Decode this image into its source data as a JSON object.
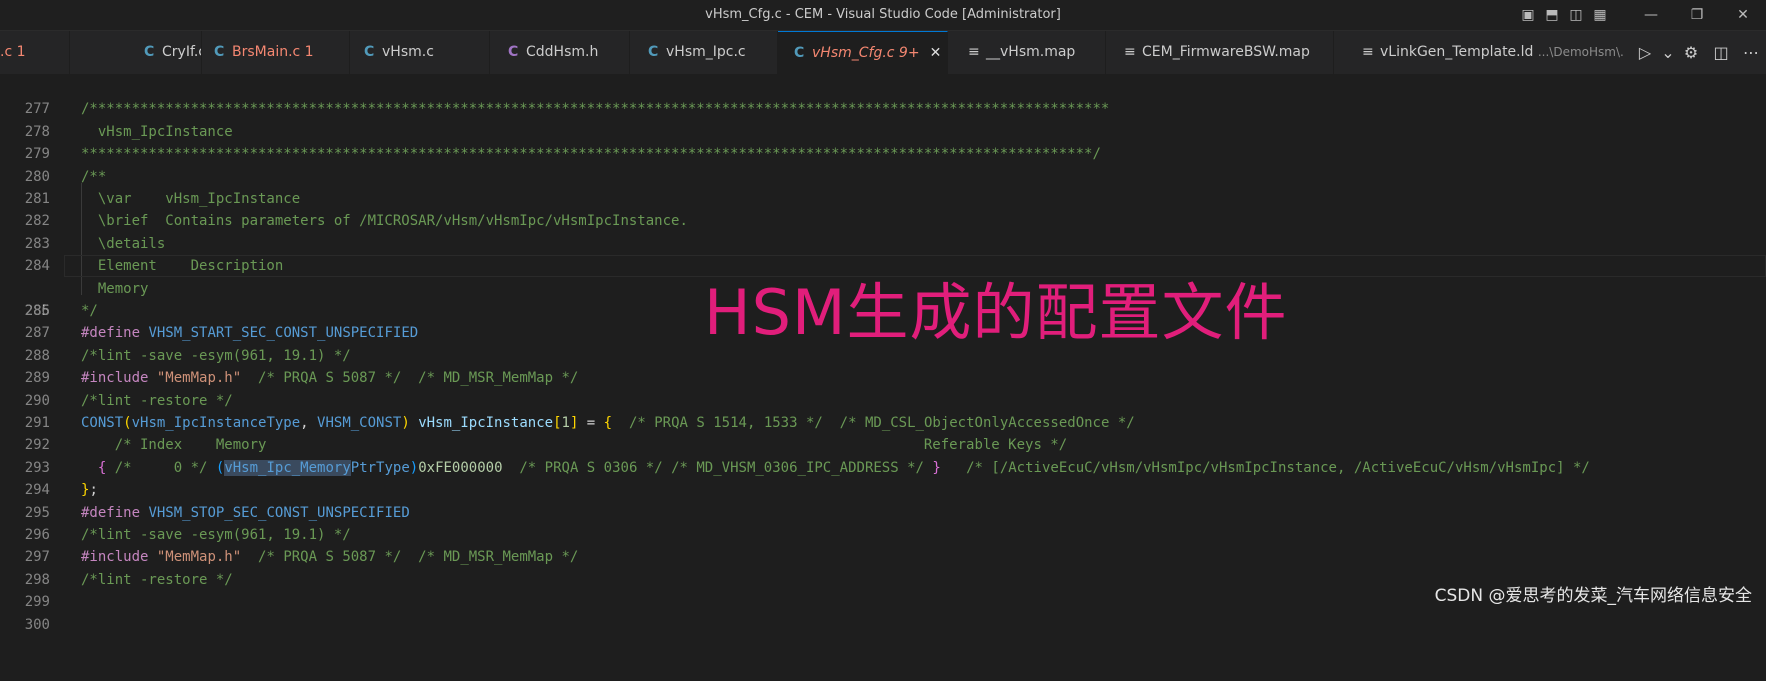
{
  "window": {
    "title": "vHsm_Cfg.c - CEM - Visual Studio Code [Administrator]",
    "controls": [
      "layout-sidebar-icon",
      "layout-panel-icon",
      "layout-sidebar-right-icon",
      "layout-custom-icon",
      "minimize-icon",
      "restore-icon",
      "close-icon"
    ],
    "control_glyphs": [
      "▣",
      "⬒",
      "◫",
      "▦",
      "—",
      "❐",
      "✕"
    ]
  },
  "tabs": [
    {
      "icon": "",
      "label": ".c 1",
      "status": "error"
    },
    {
      "icon": "C",
      "label": "CryIf.c",
      "status": ""
    },
    {
      "icon": "C",
      "label": "BrsMain.c 1",
      "status": "error"
    },
    {
      "icon": "C",
      "label": "vHsm.c",
      "status": ""
    },
    {
      "icon": "C",
      "label": "CddHsm.h",
      "status": ""
    },
    {
      "icon": "C",
      "label": "vHsm_Ipc.c",
      "status": ""
    },
    {
      "icon": "C",
      "label": "vHsm_Cfg.c 9+",
      "status": "active-modified",
      "close": "✕"
    },
    {
      "icon": "≡",
      "label": "__vHsm.map",
      "status": ""
    },
    {
      "icon": "≡",
      "label": "CEM_FirmwareBSW.map",
      "status": ""
    },
    {
      "icon": "≡",
      "label": "vLinkGen_Template.ld",
      "suffix": "...\\DemoHsm\\...",
      "status": ""
    }
  ],
  "tab_actions": {
    "glyphs": [
      "▷",
      "⌄",
      "⚙",
      "◫",
      "⋯"
    ]
  },
  "editor": {
    "current_line": "285",
    "lines": [
      {
        "n": "277",
        "t": ""
      },
      {
        "n": "278",
        "t": "/*************************************************************************************************************************"
      },
      {
        "n": "279",
        "t": "  vHsm_IpcInstance"
      },
      {
        "n": "280",
        "t": "************************************************************************************************************************/"
      },
      {
        "n": "281",
        "t": "/**"
      },
      {
        "n": "282",
        "t": "  \\var    vHsm_IpcInstance"
      },
      {
        "n": "283",
        "t": "  \\brief  Contains parameters of /MICROSAR/vHsm/vHsmIpc/vHsmIpcInstance."
      },
      {
        "n": "284",
        "t": "  \\details"
      },
      {
        "n": "285",
        "t": "  Element    Description"
      },
      {
        "n": "286",
        "t": "  Memory"
      },
      {
        "n": "287",
        "t": "*/"
      },
      {
        "n": "288",
        "t": "#define VHSM_START_SEC_CONST_UNSPECIFIED"
      },
      {
        "n": "289",
        "t": "/*lint -save -esym(961, 19.1) */"
      },
      {
        "n": "290",
        "t": "#include \"MemMap.h\"  /* PRQA S 5087 */  /* MD_MSR_MemMap */"
      },
      {
        "n": "291",
        "t": "/*lint -restore */"
      },
      {
        "n": "292",
        "t": "CONST(vHsm_IpcInstanceType, VHSM_CONST) vHsm_IpcInstance[1] = {  /* PRQA S 1514, 1533 */  /* MD_CSL_ObjectOnlyAccessedOnce */"
      },
      {
        "n": "293",
        "t": "    /* Index    Memory                                                                              Referable Keys */"
      },
      {
        "n": "294",
        "t": "  { /*     0 */ (vHsm_Ipc_MemoryPtrType)0xFE000000  /* PRQA S 0306 */ /* MD_VHSM_0306_IPC_ADDRESS */ }   /* [/ActiveEcuC/vHsm/vHsmIpc/vHsmIpcInstance, /ActiveEcuC/vHsm/vHsmIpc] */"
      },
      {
        "n": "295",
        "t": "};"
      },
      {
        "n": "296",
        "t": "#define VHSM_STOP_SEC_CONST_UNSPECIFIED"
      },
      {
        "n": "297",
        "t": "/*lint -save -esym(961, 19.1) */"
      },
      {
        "n": "298",
        "t": "#include \"MemMap.h\"  /* PRQA S 5087 */  /* MD_MSR_MemMap */"
      },
      {
        "n": "299",
        "t": "/*lint -restore */"
      },
      {
        "n": "300",
        "t": ""
      }
    ]
  },
  "overlay_text": "HSM生成的配置文件",
  "watermark": "CSDN @爱思考的发菜_汽车网络信息安全",
  "colors": {
    "comment": "#6a9955",
    "preprocessor": "#c586c0",
    "macro": "#569cd6",
    "string": "#ce9178",
    "overlay": "#e11e7b",
    "background": "#1e1e1e"
  }
}
